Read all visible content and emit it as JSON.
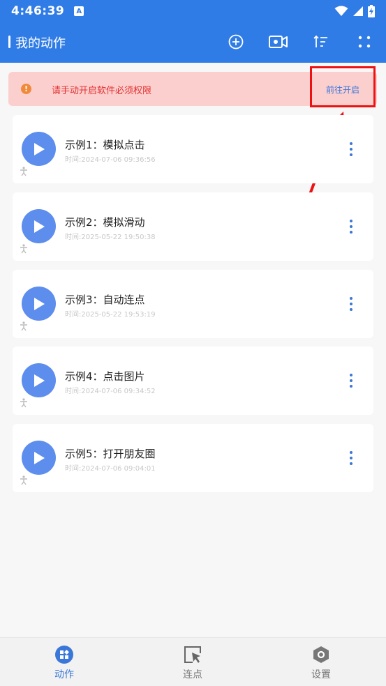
{
  "status_bar": {
    "time": "4:46:39",
    "notification_letter": "A"
  },
  "app_bar": {
    "title": "我的动作",
    "icons": [
      "add-circle-icon",
      "video-record-icon",
      "sort-icon",
      "grid-dots-icon"
    ]
  },
  "banner": {
    "message": "请手动开启软件必须权限",
    "action_label": "前往开启",
    "icon_glyph": "!"
  },
  "actions": [
    {
      "title": "示例1：模拟点击",
      "time": "时间:2024-07-06 09:36:56"
    },
    {
      "title": "示例2：模拟滑动",
      "time": "时间:2025-05-22 19:50:38"
    },
    {
      "title": "示例3：自动连点",
      "time": "时间:2025-05-22 19:53:19"
    },
    {
      "title": "示例4：点击图片",
      "time": "时间:2024-07-06 09:34:52"
    },
    {
      "title": "示例5：打开朋友圈",
      "time": "时间:2024-07-06 09:04:01"
    }
  ],
  "bottom_nav": [
    {
      "label": "动作",
      "active": true
    },
    {
      "label": "连点",
      "active": false
    },
    {
      "label": "设置",
      "active": false
    }
  ],
  "colors": {
    "primary": "#2f7ce6",
    "play_button": "#5d8ded",
    "banner_bg": "#fccfcf",
    "banner_text": "#e23030",
    "highlight": "#ee1111",
    "nav_active": "#3a77d8",
    "nav_inactive": "#777777"
  }
}
